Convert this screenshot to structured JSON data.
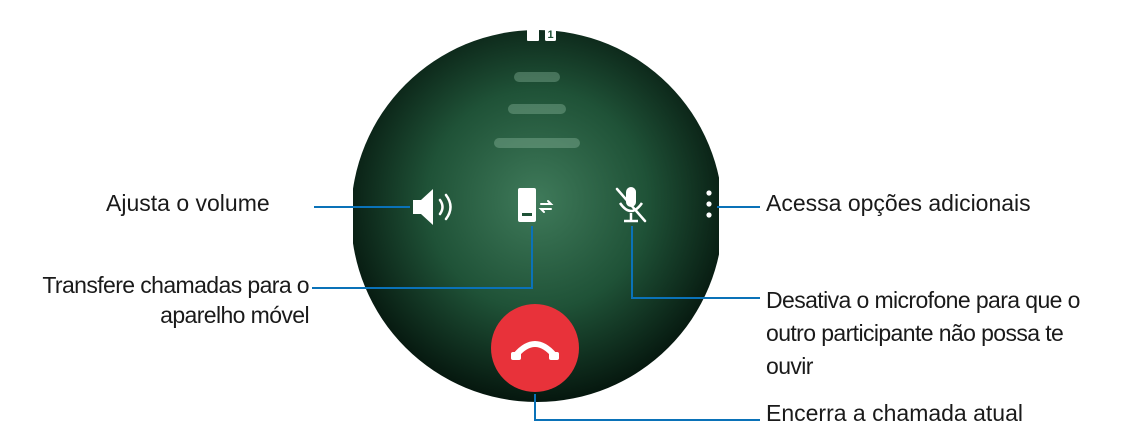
{
  "callouts": {
    "volume": "Ajusta o volume",
    "transfer_line1": "Transfere chamadas para o",
    "transfer_line2": "aparelho móvel",
    "options": "Acessa opções adicionais",
    "mute_line1": "Desativa o microfone para que o",
    "mute_line2": "outro participante não possa te",
    "mute_line3": "ouvir",
    "end_call": "Encerra a chamada atual"
  },
  "status_bar": {
    "sim_badge": "1"
  },
  "icons": {
    "volume": "speaker-volume-icon",
    "transfer": "phone-transfer-icon",
    "mute": "microphone-off-icon",
    "more": "more-vertical-icon",
    "end_call": "end-call-icon",
    "lock": "lock-icon",
    "sim": "sim-icon"
  },
  "colors": {
    "screen_center": "#3f7a5a",
    "screen_edge": "#06180f",
    "end_call_button": "#e8323a",
    "callout_line": "#0a72b8"
  }
}
